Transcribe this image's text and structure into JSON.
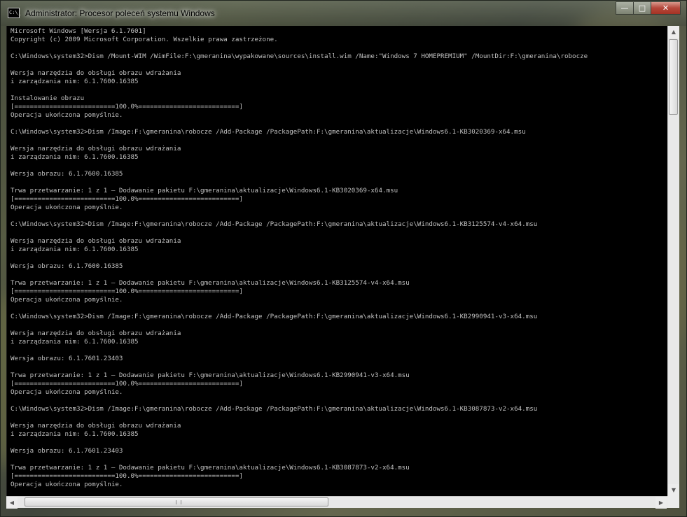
{
  "window": {
    "title": "Administrator: Procesor poleceń systemu Windows",
    "icon_label": "C:\\_",
    "buttons": {
      "minimize": "—",
      "maximize": "□",
      "close": "✕"
    }
  },
  "console": {
    "lines": [
      "Microsoft Windows [Wersja 6.1.7601]",
      "Copyright (c) 2009 Microsoft Corporation. Wszelkie prawa zastrzeżone.",
      "",
      "C:\\Windows\\system32>Dism /Mount-WIM /WimFile:F:\\gmeranina\\wypakowane\\sources\\install.wim /Name:\"Windows 7 HOMEPREMIUM\" /MountDir:F:\\gmeranina\\robocze",
      "",
      "Wersja narzędzia do obsługi obrazu wdrażania",
      "i zarządzania nim: 6.1.7600.16385",
      "",
      "Instalowanie obrazu",
      "[==========================100.0%==========================]",
      "Operacja ukończona pomyślnie.",
      "",
      "C:\\Windows\\system32>Dism /Image:F:\\gmeranina\\robocze /Add-Package /PackagePath:F:\\gmeranina\\aktualizacje\\Windows6.1-KB3020369-x64.msu",
      "",
      "Wersja narzędzia do obsługi obrazu wdrażania",
      "i zarządzania nim: 6.1.7600.16385",
      "",
      "Wersja obrazu: 6.1.7600.16385",
      "",
      "Trwa przetwarzanie: 1 z 1 — Dodawanie pakietu F:\\gmeranina\\aktualizacje\\Windows6.1-KB3020369-x64.msu",
      "[==========================100.0%==========================]",
      "Operacja ukończona pomyślnie.",
      "",
      "C:\\Windows\\system32>Dism /Image:F:\\gmeranina\\robocze /Add-Package /PackagePath:F:\\gmeranina\\aktualizacje\\Windows6.1-KB3125574-v4-x64.msu",
      "",
      "Wersja narzędzia do obsługi obrazu wdrażania",
      "i zarządzania nim: 6.1.7600.16385",
      "",
      "Wersja obrazu: 6.1.7600.16385",
      "",
      "Trwa przetwarzanie: 1 z 1 — Dodawanie pakietu F:\\gmeranina\\aktualizacje\\Windows6.1-KB3125574-v4-x64.msu",
      "[==========================100.0%==========================]",
      "Operacja ukończona pomyślnie.",
      "",
      "C:\\Windows\\system32>Dism /Image:F:\\gmeranina\\robocze /Add-Package /PackagePath:F:\\gmeranina\\aktualizacje\\Windows6.1-KB2990941-v3-x64.msu",
      "",
      "Wersja narzędzia do obsługi obrazu wdrażania",
      "i zarządzania nim: 6.1.7600.16385",
      "",
      "Wersja obrazu: 6.1.7601.23403",
      "",
      "Trwa przetwarzanie: 1 z 1 — Dodawanie pakietu F:\\gmeranina\\aktualizacje\\Windows6.1-KB2990941-v3-x64.msu",
      "[==========================100.0%==========================]",
      "Operacja ukończona pomyślnie.",
      "",
      "C:\\Windows\\system32>Dism /Image:F:\\gmeranina\\robocze /Add-Package /PackagePath:F:\\gmeranina\\aktualizacje\\Windows6.1-KB3087873-v2-x64.msu",
      "",
      "Wersja narzędzia do obsługi obrazu wdrażania",
      "i zarządzania nim: 6.1.7600.16385",
      "",
      "Wersja obrazu: 6.1.7601.23403",
      "",
      "Trwa przetwarzanie: 1 z 1 — Dodawanie pakietu F:\\gmeranina\\aktualizacje\\Windows6.1-KB3087873-v2-x64.msu",
      "[==========================100.0%==========================]",
      "Operacja ukończona pomyślnie."
    ]
  },
  "scrollbars": {
    "up_arrow": "▲",
    "down_arrow": "▼",
    "left_arrow": "◀",
    "right_arrow": "▶"
  },
  "colors": {
    "console_bg": "#000000",
    "console_fg": "#c0c0c0",
    "close_button": "#b5473a"
  }
}
